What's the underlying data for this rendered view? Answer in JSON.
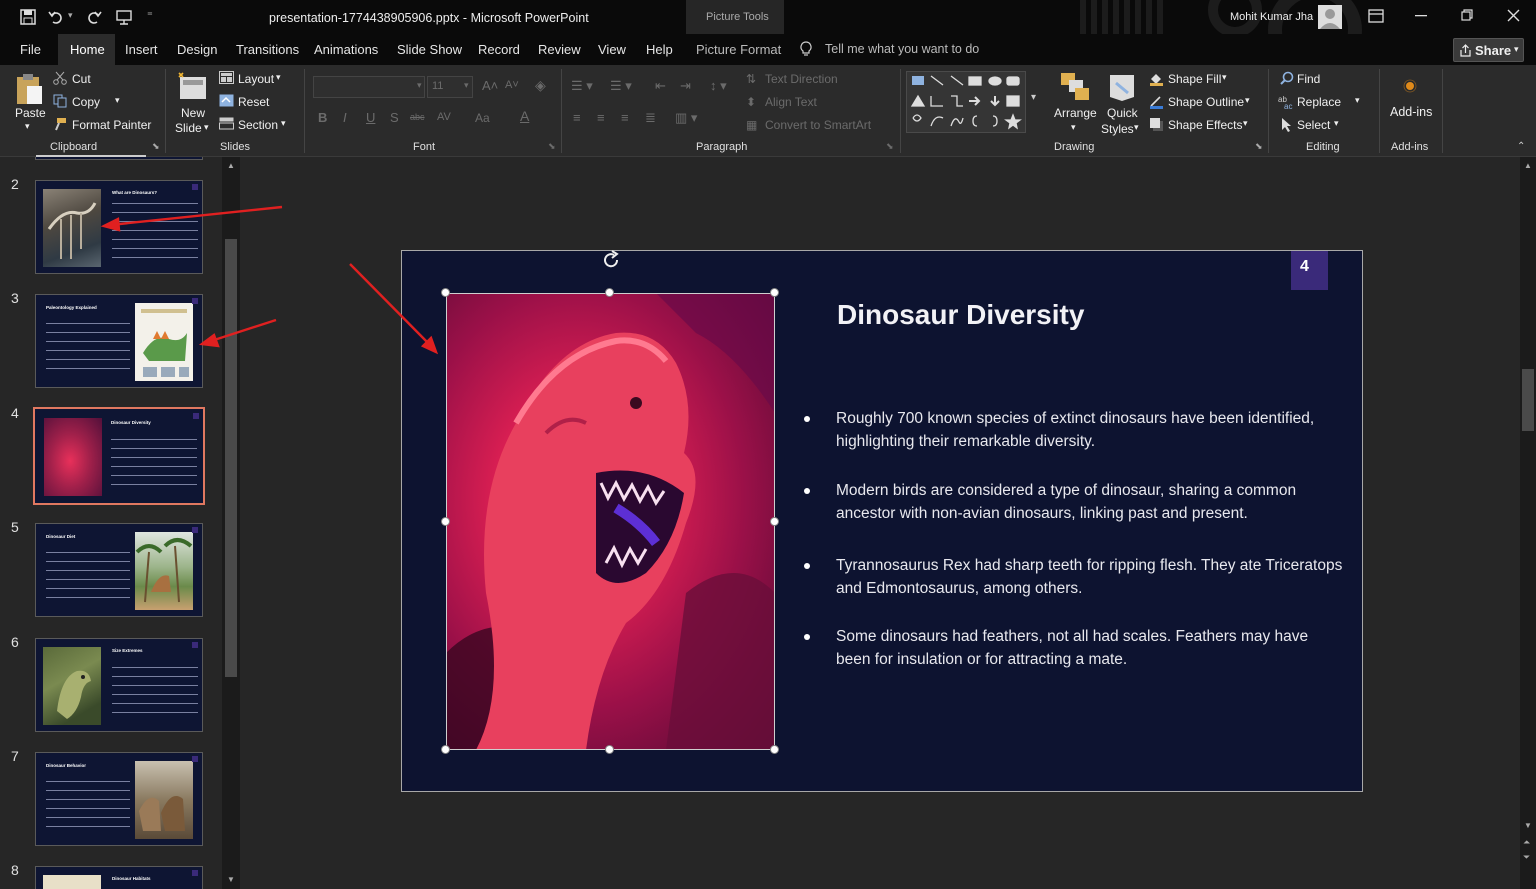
{
  "titlebar": {
    "filename": "presentation-1774438905906.pptx",
    "separator": "-",
    "app": "Microsoft PowerPoint",
    "context_group": "Picture Tools",
    "user": "Mohit Kumar Jha"
  },
  "menu": {
    "tabs": [
      "File",
      "Home",
      "Insert",
      "Design",
      "Transitions",
      "Animations",
      "Slide Show",
      "Record",
      "Review",
      "View",
      "Help",
      "Picture Format"
    ],
    "tell_me": "Tell me what you want to do",
    "share": "Share"
  },
  "ribbon": {
    "clipboard": {
      "paste": "Paste",
      "cut": "Cut",
      "copy": "Copy",
      "format_painter": "Format Painter",
      "label": "Clipboard"
    },
    "slides": {
      "new_slide_1": "New",
      "new_slide_2": "Slide",
      "layout": "Layout",
      "reset": "Reset",
      "section": "Section",
      "label": "Slides"
    },
    "font": {
      "size": "11",
      "label": "Font"
    },
    "paragraph": {
      "text_direction": "Text Direction",
      "align_text": "Align Text",
      "convert_smartart": "Convert to SmartArt",
      "label": "Paragraph"
    },
    "drawing": {
      "arrange": "Arrange",
      "quick_styles_1": "Quick",
      "quick_styles_2": "Styles",
      "shape_fill": "Shape Fill",
      "shape_outline": "Shape Outline",
      "shape_effects": "Shape Effects",
      "label": "Drawing"
    },
    "editing": {
      "find": "Find",
      "replace": "Replace",
      "select": "Select",
      "label": "Editing"
    },
    "addins": {
      "addins": "Add-ins",
      "label": "Add-ins"
    }
  },
  "thumbnails": [
    {
      "num": "2",
      "title": "What are Dinosaurs?"
    },
    {
      "num": "3",
      "title": "Paleontology Explained"
    },
    {
      "num": "4",
      "title": "Dinosaur Diversity"
    },
    {
      "num": "5",
      "title": "Dinosaur Diet"
    },
    {
      "num": "6",
      "title": "Size Extremes"
    },
    {
      "num": "7",
      "title": "Dinosaur Behavior"
    },
    {
      "num": "8",
      "title": "Dinosaur Habitats"
    }
  ],
  "slide": {
    "number": "4",
    "title": "Dinosaur Diversity",
    "bullets": [
      "Roughly 700 known species of extinct dinosaurs have been identified, highlighting their remarkable diversity.",
      "Modern birds are considered a type of dinosaur, sharing a common ancestor with non-avian dinosaurs, linking past and present.",
      "Tyrannosaurus Rex had sharp teeth for ripping flesh. They ate Triceratops and Edmontosaurus, among others.",
      "Some dinosaurs had feathers, not all had scales. Feathers may have been for insulation or for attracting a mate."
    ]
  },
  "colors": {
    "accent": "#e07860",
    "slide_bg": "#0d1330",
    "badge": "#3a2a7a",
    "arrow": "#e02020"
  }
}
